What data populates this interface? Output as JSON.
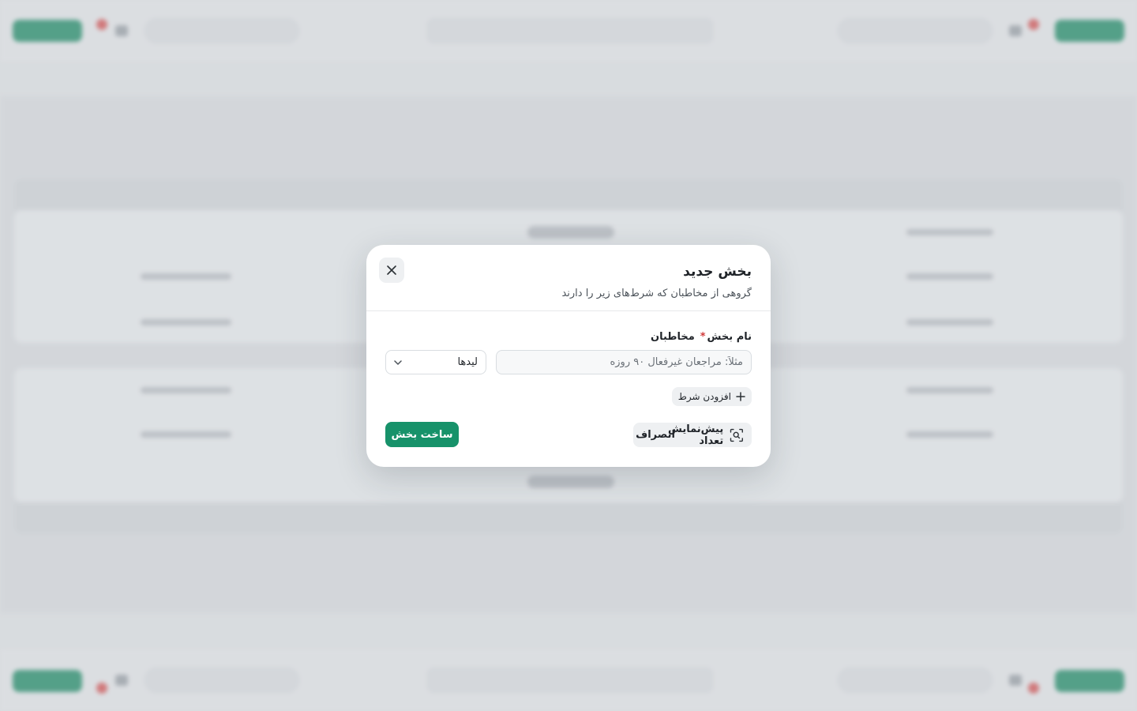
{
  "modal": {
    "title": "بخش جدید",
    "subtitle": "گروهی از مخاطبان که شرط‌های زیر را دارند",
    "name_label": "نام بخش",
    "name_required_mark": "*",
    "name_placeholder": "مثلاً: مراجعان غیرفعال ۹۰ روزه",
    "name_value": "",
    "audience_label": "مخاطبان",
    "audience_selected": "لیدها",
    "add_condition_label": "افزودن شرط",
    "preview_label": "پیش‌نمایش تعداد",
    "cancel_label": "انصراف",
    "create_label": "ساخت بخش"
  },
  "colors": {
    "primary": "#17926a",
    "required": "#d13b3b"
  },
  "icons": {
    "close": "close-icon",
    "chevron": "chevron-down-icon",
    "plus": "plus-icon",
    "preview": "scan-search-icon"
  }
}
